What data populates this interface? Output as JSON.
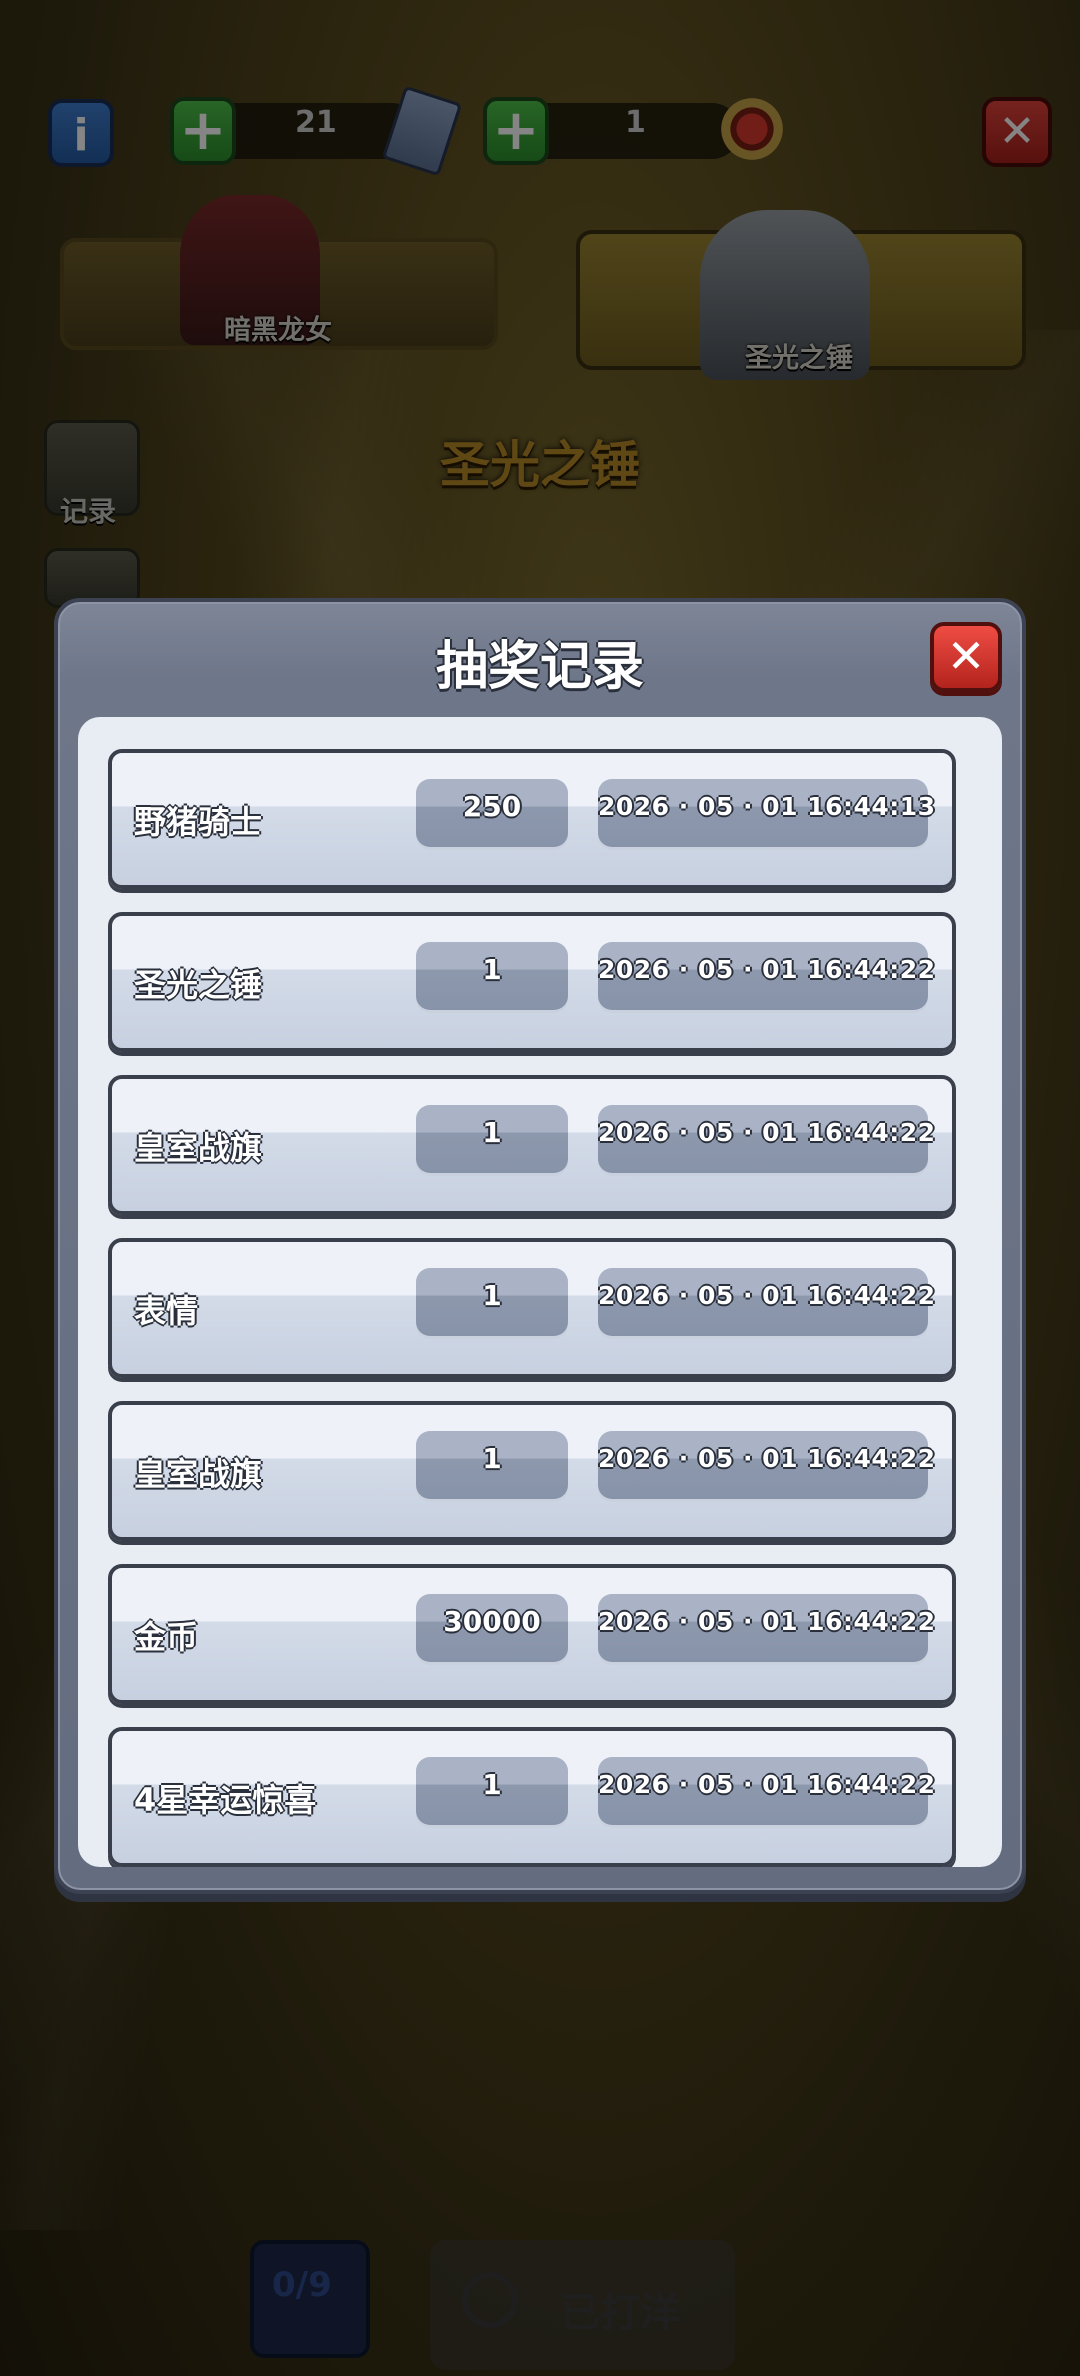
{
  "topbar": {
    "info_icon": "info-icon",
    "resource1_value": "21",
    "resource2_value": "1",
    "close_icon": "close-icon"
  },
  "heroes": {
    "left_name": "暗黑龙女",
    "right_name": "圣光之锤",
    "selected_title": "圣光之锤"
  },
  "sidebar": {
    "record_label": "记录"
  },
  "bottom": {
    "count": "0/9",
    "action_label": "已打洋"
  },
  "modal": {
    "title": "抽奖记录",
    "close_glyph": "✕",
    "records": [
      {
        "name": "野猪骑士",
        "amount": "250",
        "time": "2026 · 05 · 01  16:44:13"
      },
      {
        "name": "圣光之锤",
        "amount": "1",
        "time": "2026 · 05 · 01  16:44:22"
      },
      {
        "name": "皇室战旗",
        "amount": "1",
        "time": "2026 · 05 · 01  16:44:22"
      },
      {
        "name": "表情",
        "amount": "1",
        "time": "2026 · 05 · 01  16:44:22"
      },
      {
        "name": "皇室战旗",
        "amount": "1",
        "time": "2026 · 05 · 01  16:44:22"
      },
      {
        "name": "金币",
        "amount": "30000",
        "time": "2026 · 05 · 01  16:44:22"
      },
      {
        "name": "4星幸运惊喜",
        "amount": "1",
        "time": "2026 · 05 · 01  16:44:22"
      }
    ]
  }
}
